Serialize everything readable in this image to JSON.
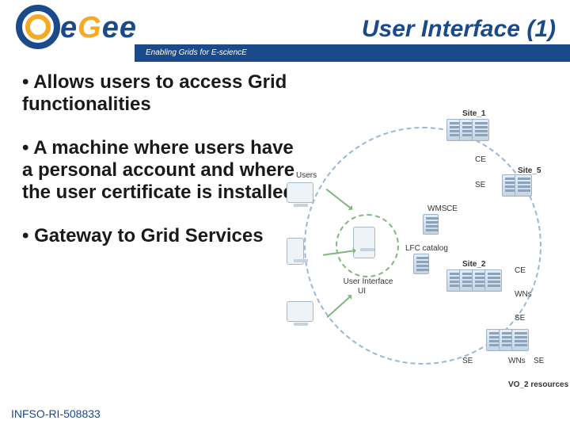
{
  "header": {
    "logo_text_e1": "e",
    "logo_text_g": "G",
    "logo_text_e2": "e",
    "logo_text_e3": "e",
    "title": "User Interface  (1)",
    "tagline": "Enabling Grids for E-sciencE"
  },
  "bullets": [
    "Allows users to access Grid functionalities",
    "A machine where users have a personal account and where the user certificate is installed",
    "Gateway to Grid Services"
  ],
  "diagram": {
    "users": "Users",
    "ui": "User Interface",
    "ui2": "UI",
    "wms": "WMS",
    "ce": "CE",
    "se": "SE",
    "wns": "WNs",
    "lfc": "LFC catalog",
    "site1": "Site_1",
    "site2": "Site_2",
    "site5": "Site_5",
    "vo2": "VO_2 resources"
  },
  "footer": {
    "ref": "INFSO-RI-508833"
  }
}
